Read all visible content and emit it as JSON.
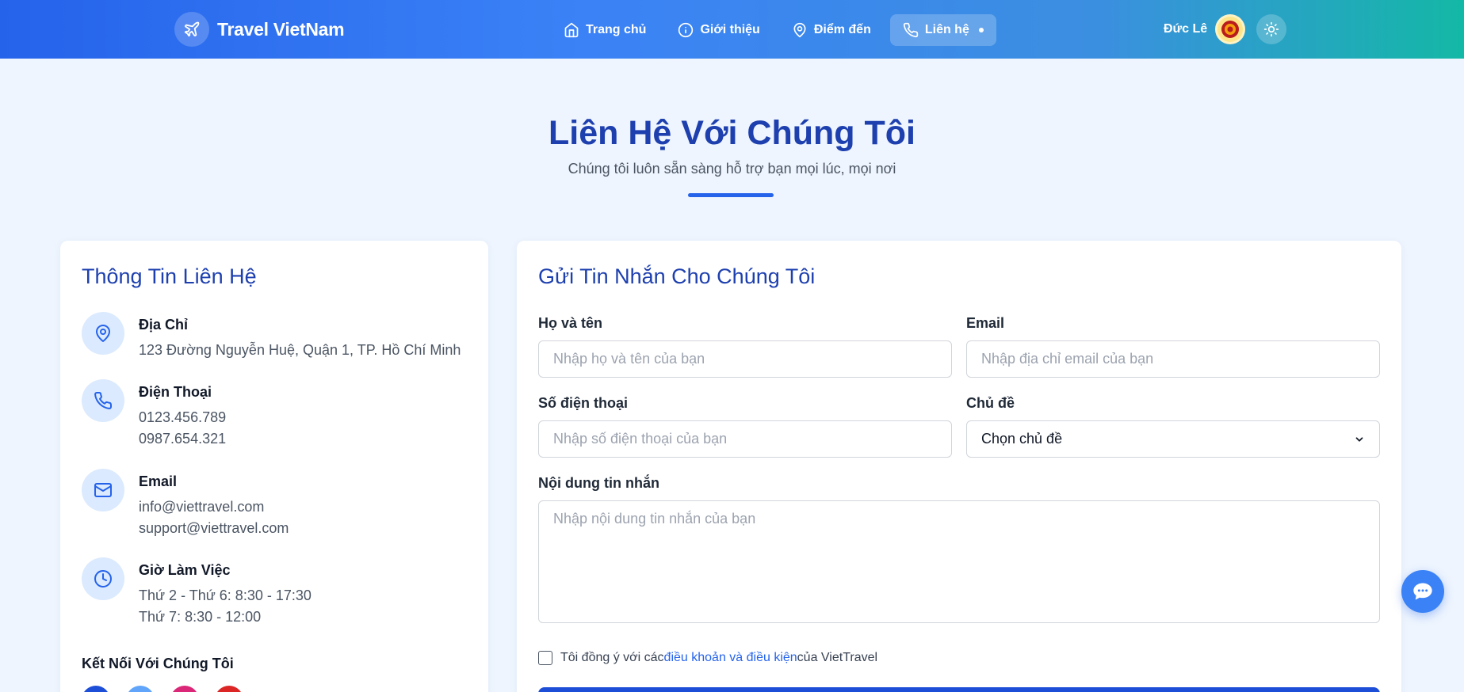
{
  "header": {
    "brand": "Travel VietNam",
    "nav": [
      {
        "label": "Trang chủ",
        "icon": "home-icon"
      },
      {
        "label": "Giới thiệu",
        "icon": "info-icon"
      },
      {
        "label": "Điểm đến",
        "icon": "map-pin-icon"
      },
      {
        "label": "Liên hệ",
        "icon": "phone-icon",
        "active": true
      }
    ],
    "user_name": "Đức Lê"
  },
  "hero": {
    "title": "Liên Hệ Với Chúng Tôi",
    "subtitle": "Chúng tôi luôn sẵn sàng hỗ trợ bạn mọi lúc, mọi nơi"
  },
  "contact_info": {
    "title": "Thông Tin Liên Hệ",
    "items": [
      {
        "label": "Địa Chỉ",
        "lines": [
          "123 Đường Nguyễn Huệ, Quận 1, TP. Hồ Chí Minh"
        ]
      },
      {
        "label": "Điện Thoại",
        "lines": [
          "0123.456.789",
          "0987.654.321"
        ]
      },
      {
        "label": "Email",
        "lines": [
          "info@viettravel.com",
          "support@viettravel.com"
        ]
      },
      {
        "label": "Giờ Làm Việc",
        "lines": [
          "Thứ 2 - Thứ 6: 8:30 - 17:30",
          "Thứ 7: 8:30 - 12:00"
        ]
      }
    ],
    "connect_title": "Kết Nối Với Chúng Tôi"
  },
  "form": {
    "title": "Gửi Tin Nhắn Cho Chúng Tôi",
    "name_label": "Họ và tên",
    "name_placeholder": "Nhập họ và tên của bạn",
    "email_label": "Email",
    "email_placeholder": "Nhập địa chỉ email của bạn",
    "phone_label": "Số điện thoại",
    "phone_placeholder": "Nhập số điện thoại của bạn",
    "topic_label": "Chủ đề",
    "topic_value": "Chọn chủ đề",
    "message_label": "Nội dung tin nhắn",
    "message_placeholder": "Nhập nội dung tin nhắn của bạn",
    "agree_prefix": "Tôi đồng ý với các",
    "agree_link": "điều khoản và điều kiện",
    "agree_suffix": "của VietTravel"
  },
  "colors": {
    "primary": "#2563eb",
    "heading": "#1e40af",
    "icon_bg": "#dbeafe",
    "page_bg": "#eef5fe"
  }
}
